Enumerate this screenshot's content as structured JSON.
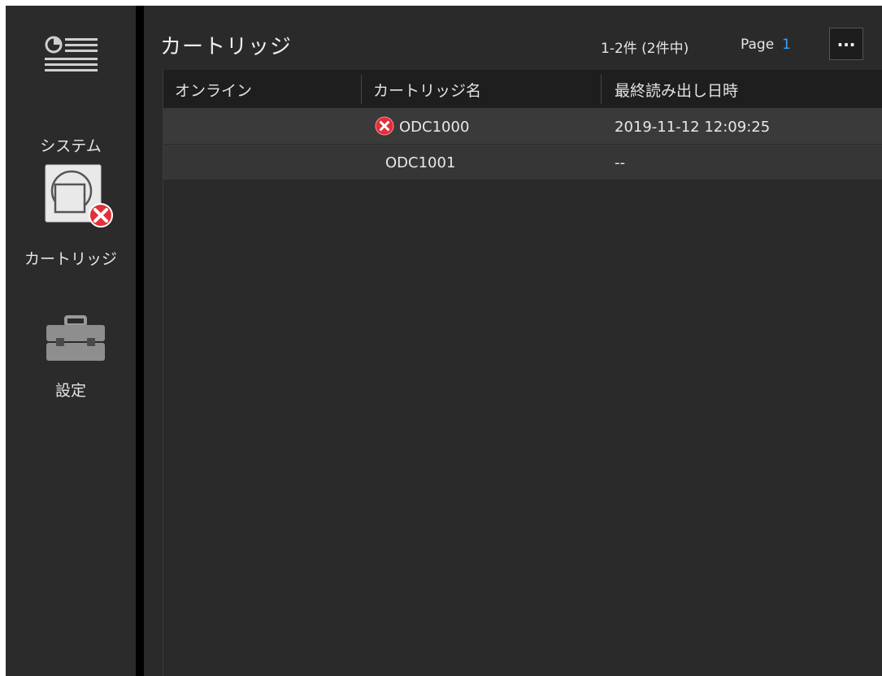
{
  "sidebar": {
    "items": [
      {
        "label": "システム",
        "icon": "system-list-icon"
      },
      {
        "label": "カートリッジ",
        "icon": "cartridge-error-icon"
      },
      {
        "label": "設定",
        "icon": "toolbox-icon"
      }
    ]
  },
  "header": {
    "title": "カートリッジ",
    "count_info": "1-2件 (2件中)",
    "page_label": "Page",
    "page_number": "1",
    "more_label": "..."
  },
  "table": {
    "columns": [
      "オンライン",
      "カートリッジ名",
      "最終読み出し日時"
    ],
    "rows": [
      {
        "online": "",
        "name": "ODC1000",
        "last_read": "2019-11-12 12:09:25",
        "status": "error"
      },
      {
        "online": "",
        "name": "ODC1001",
        "last_read": "--",
        "status": ""
      }
    ]
  },
  "colors": {
    "background": "#2a2a2a",
    "sidebar": "#2b2b2b",
    "accent": "#3aa0ff",
    "error": "#e0303a"
  }
}
